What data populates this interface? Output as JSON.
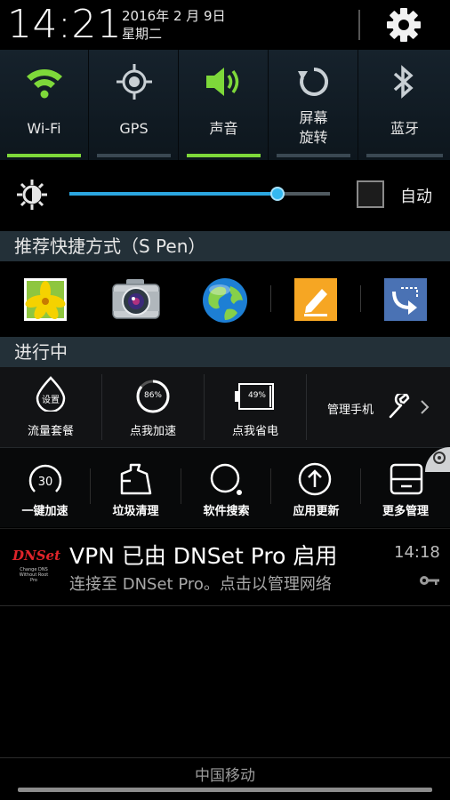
{
  "status": {
    "time": "14:21",
    "date": "2016年 2 月 9日",
    "weekday": "星期二"
  },
  "quick_settings": [
    {
      "label": "Wi-Fi",
      "icon": "wifi-icon",
      "active": true
    },
    {
      "label": "GPS",
      "icon": "gps-icon",
      "active": false
    },
    {
      "label": "声音",
      "icon": "sound-icon",
      "active": true
    },
    {
      "label": "屏幕\n旋转",
      "line1": "屏幕",
      "line2": "旋转",
      "icon": "rotate-icon",
      "active": false
    },
    {
      "label": "蓝牙",
      "icon": "bluetooth-icon",
      "active": false
    }
  ],
  "brightness": {
    "level": 0.8,
    "auto_label": "自动",
    "auto_checked": false
  },
  "spen": {
    "title": "推荐快捷方式（S Pen）",
    "apps": [
      "gallery-icon",
      "camera-icon",
      "browser-icon",
      "memo-icon",
      "scrapbook-icon"
    ]
  },
  "ongoing": {
    "title": "进行中",
    "items": [
      {
        "label": "流量套餐",
        "badge": "设置"
      },
      {
        "label": "点我加速",
        "badge": "86%"
      },
      {
        "label": "点我省电",
        "badge": "49%"
      },
      {
        "label": "管理手机"
      }
    ]
  },
  "tools": [
    {
      "label": "一键加速",
      "badge": "30"
    },
    {
      "label": "垃圾清理"
    },
    {
      "label": "软件搜索"
    },
    {
      "label": "应用更新"
    },
    {
      "label": "更多管理"
    }
  ],
  "notification": {
    "title": "VPN 已由 DNSet Pro 启用",
    "text": "连接至 DNSet Pro。点击以管理网络",
    "time": "14:18",
    "logo_text": "DNSet",
    "logo_sub1": "Change DNS",
    "logo_sub2": "Without Root",
    "logo_sub3": "Pro"
  },
  "carrier": "中国移动",
  "colors": {
    "accent_green": "#7ed83a",
    "accent_blue": "#2ba6e0",
    "logo_red": "#e0242a"
  }
}
